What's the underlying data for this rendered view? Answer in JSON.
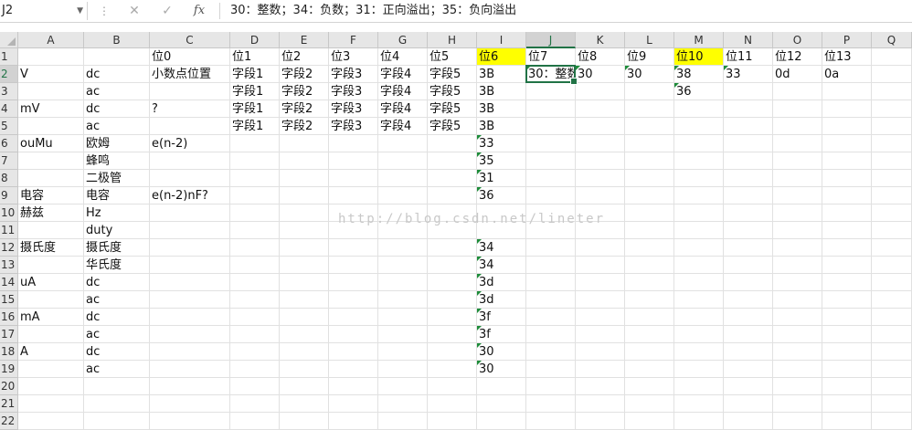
{
  "formula_bar": {
    "name_box": "J2",
    "name_dropdown": "▼",
    "dots": "⋮",
    "cancel_icon": "✕",
    "enter_icon": "✓",
    "fx_label": "fx",
    "content": "30：整数；34：负数；31：正向溢出；35：负向溢出"
  },
  "watermark": "http://blog.csdn.net/lineter",
  "columns": [
    "A",
    "B",
    "C",
    "D",
    "E",
    "F",
    "G",
    "H",
    "I",
    "J",
    "K",
    "L",
    "M",
    "N",
    "O",
    "P",
    "Q"
  ],
  "rows": [
    "1",
    "2",
    "3",
    "4",
    "5",
    "6",
    "7",
    "8",
    "9",
    "10",
    "11",
    "12",
    "13",
    "14",
    "15",
    "16",
    "17",
    "18",
    "19",
    "20",
    "21",
    "22"
  ],
  "cells": {
    "1": {
      "C": "位0",
      "D": "位1",
      "E": "位2",
      "F": "位3",
      "G": "位4",
      "H": "位5",
      "I": "位6",
      "J": "位7",
      "K": "位8",
      "L": "位9",
      "M": "位10",
      "N": "位11",
      "O": "位12",
      "P": "位13"
    },
    "2": {
      "A": "V",
      "B": "dc",
      "C": "小数点位置",
      "D": "字段1",
      "E": "字段2",
      "F": "字段3",
      "G": "字段4",
      "H": "字段5",
      "I": "3B",
      "J": "30：整数",
      "K": "30",
      "L": "30",
      "M": "38",
      "N": "33",
      "O": "0d",
      "P": "0a"
    },
    "3": {
      "B": "ac",
      "D": "字段1",
      "E": "字段2",
      "F": "字段3",
      "G": "字段4",
      "H": "字段5",
      "I": "3B",
      "M": "36"
    },
    "4": {
      "A": "mV",
      "B": "dc",
      "C": "?",
      "D": "字段1",
      "E": "字段2",
      "F": "字段3",
      "G": "字段4",
      "H": "字段5",
      "I": "3B"
    },
    "5": {
      "B": "ac",
      "D": "字段1",
      "E": "字段2",
      "F": "字段3",
      "G": "字段4",
      "H": "字段5",
      "I": "3B"
    },
    "6": {
      "A": "ouMu",
      "B": "欧姆",
      "C": "e(n-2)",
      "I": "33"
    },
    "7": {
      "B": "蜂鸣",
      "I": "35"
    },
    "8": {
      "B": "二极管",
      "I": "31"
    },
    "9": {
      "A": "电容",
      "B": "电容",
      "C": "e(n-2)nF?",
      "I": "36"
    },
    "10": {
      "A": "赫兹",
      "B": "Hz"
    },
    "11": {
      "B": "duty"
    },
    "12": {
      "A": "摄氏度",
      "B": "摄氏度",
      "I": "34"
    },
    "13": {
      "B": "华氏度",
      "I": "34"
    },
    "14": {
      "A": "uA",
      "B": "dc",
      "I": "3d"
    },
    "15": {
      "B": "ac",
      "I": "3d"
    },
    "16": {
      "A": "mA",
      "B": "dc",
      "I": "3f"
    },
    "17": {
      "B": "ac",
      "I": "3f"
    },
    "18": {
      "A": "A",
      "B": "dc",
      "I": "30"
    },
    "19": {
      "B": "ac",
      "I": "30"
    }
  },
  "highlight_color": "#ffff00",
  "accent_color": "#217346"
}
